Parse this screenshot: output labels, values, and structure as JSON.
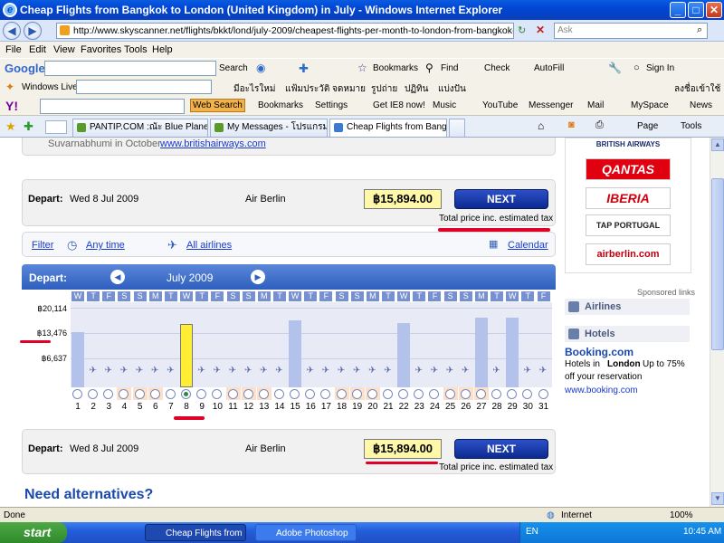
{
  "window": {
    "title": "Cheap Flights from Bangkok to London (United Kingdom) in July - Windows Internet Explorer",
    "min": "_",
    "max": "□",
    "close": "✕"
  },
  "address": {
    "url": "http://www.skyscanner.net/flights/bkkt/lond/july-2009/cheapest-flights-per-month-to-london-from-bangkok-in-july-2009.htm",
    "search_placeholder": "Ask"
  },
  "menu": [
    "File",
    "Edit",
    "View",
    "Favorites",
    "Tools",
    "Help"
  ],
  "google_bar": {
    "logo": "Google",
    "search": "Search",
    "bookmarks": "Bookmarks",
    "find": "Find",
    "check": "Check",
    "autofill": "AutoFill",
    "signin": "Sign In"
  },
  "live_bar": {
    "label": "Windows Live",
    "links": [
      "มีอะไรใหม่",
      "แฟ้มประวัติ",
      "จดหมาย",
      "รูปถ่าย",
      "ปฏิทิน",
      "แบ่งปัน"
    ],
    "signin": "ลงชื่อเข้าใช้"
  },
  "yahoo_bar": {
    "web_search": "Web Search",
    "bookmarks": "Bookmarks",
    "settings": "Settings",
    "ie8": "Get IE8 now!",
    "music": "Music",
    "youtube": "YouTube",
    "messenger": "Messenger",
    "mail": "Mail",
    "myspace": "MySpace",
    "news": "News"
  },
  "tabs": [
    {
      "label": "PANTIP.COM :ณัะ Blue Planet..."
    },
    {
      "label": "My Messages - โปรแกรมเลือส..."
    },
    {
      "label": "Cheap Flights from Bangk..."
    }
  ],
  "tab_tools": {
    "page": "Page",
    "tools": "Tools"
  },
  "top_notice": {
    "text": "Suvarnabhumi in October",
    "link": "www.britishairways.com"
  },
  "depart_top": {
    "label": "Depart:",
    "date": "Wed 8 Jul 2009",
    "airline": "Air Berlin",
    "price": "฿15,894.00",
    "next": "NEXT",
    "note": "Total price inc. estimated tax"
  },
  "filter_bar": {
    "filter": "Filter",
    "any_time": "Any time",
    "all_airlines": "All airlines",
    "calendar": "Calendar"
  },
  "calendar": {
    "depart_label": "Depart:",
    "month": "July 2009",
    "y_labels": [
      "฿20,114",
      "฿13,476",
      "฿6,637"
    ],
    "weekdays": [
      "W",
      "T",
      "F",
      "S",
      "S",
      "M",
      "T",
      "W",
      "T",
      "F",
      "S",
      "S",
      "M",
      "T",
      "W",
      "T",
      "F",
      "S",
      "S",
      "M",
      "T",
      "W",
      "T",
      "F",
      "S",
      "S",
      "M",
      "T",
      "W",
      "T",
      "F"
    ],
    "days": [
      "1",
      "2",
      "3",
      "4",
      "5",
      "6",
      "7",
      "8",
      "9",
      "10",
      "11",
      "12",
      "13",
      "14",
      "15",
      "16",
      "17",
      "18",
      "19",
      "20",
      "21",
      "22",
      "23",
      "24",
      "25",
      "26",
      "27",
      "28",
      "29",
      "30",
      "31"
    ],
    "selected_day": "8"
  },
  "chart_data": {
    "type": "bar",
    "title": "",
    "xlabel": "",
    "ylabel": "",
    "categories": [
      "1",
      "2",
      "3",
      "4",
      "5",
      "6",
      "7",
      "8",
      "9",
      "10",
      "11",
      "12",
      "13",
      "14",
      "15",
      "16",
      "17",
      "18",
      "19",
      "20",
      "21",
      "22",
      "23",
      "24",
      "25",
      "26",
      "27",
      "28",
      "29",
      "30",
      "31"
    ],
    "values": [
      13900,
      null,
      null,
      null,
      null,
      null,
      null,
      15894,
      null,
      null,
      null,
      null,
      null,
      null,
      16800,
      null,
      null,
      null,
      null,
      null,
      null,
      16300,
      null,
      null,
      null,
      null,
      17600,
      null,
      17600,
      null,
      null
    ],
    "ylim": [
      0,
      20114
    ]
  },
  "depart_bottom": {
    "label": "Depart:",
    "date": "Wed 8 Jul 2009",
    "airline": "Air Berlin",
    "price": "฿15,894.00",
    "next": "NEXT",
    "note": "Total price inc. estimated tax"
  },
  "need_alternatives": "Need alternatives?",
  "sidebar": {
    "logos": [
      "BRITISH AIRWAYS",
      "QANTAS",
      "IBERIA",
      "TAP PORTUGAL",
      "airberlin.com"
    ],
    "sponsored": "Sponsored links",
    "airlines": "Airlines",
    "hotels": "Hotels",
    "ad_title": "Booking.com",
    "ad_text_1": "Hotels in",
    "ad_city": "London",
    "ad_text_2": "Up to 75% off your reservation",
    "ad_url": "www.booking.com"
  },
  "status": {
    "text": "Done",
    "zone": "Internet",
    "zoom": "100%"
  },
  "taskbar": {
    "start": "start",
    "items": [
      "Cheap Flights from B...",
      "Adobe Photoshop"
    ],
    "lang": "EN",
    "time": "10:45 AM"
  },
  "colors": {
    "accent": "#2f5fbe",
    "price_bg": "#fff8a8",
    "highlight": "#e00028"
  }
}
